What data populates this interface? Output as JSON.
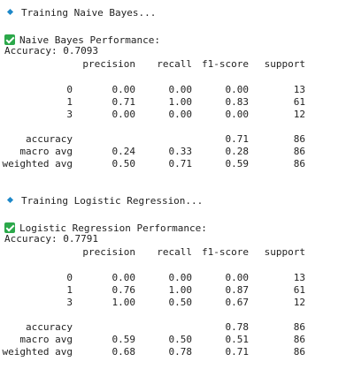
{
  "sections": [
    {
      "training_label": "Training Naive Bayes...",
      "performance_label": "Naive Bayes Performance:",
      "accuracy_line": "Accuracy: 0.7093",
      "headers": [
        "precision",
        "recall",
        "f1-score",
        "support"
      ],
      "class_rows": [
        {
          "label": "0",
          "precision": "0.00",
          "recall": "0.00",
          "f1": "0.00",
          "support": "13"
        },
        {
          "label": "1",
          "precision": "0.71",
          "recall": "1.00",
          "f1": "0.83",
          "support": "61"
        },
        {
          "label": "3",
          "precision": "0.00",
          "recall": "0.00",
          "f1": "0.00",
          "support": "12"
        }
      ],
      "summary_rows": [
        {
          "label": "accuracy",
          "precision": "",
          "recall": "",
          "f1": "0.71",
          "support": "86"
        },
        {
          "label": "macro avg",
          "precision": "0.24",
          "recall": "0.33",
          "f1": "0.28",
          "support": "86"
        },
        {
          "label": "weighted avg",
          "precision": "0.50",
          "recall": "0.71",
          "f1": "0.59",
          "support": "86"
        }
      ]
    },
    {
      "training_label": "Training Logistic Regression...",
      "performance_label": "Logistic Regression Performance:",
      "accuracy_line": "Accuracy: 0.7791",
      "headers": [
        "precision",
        "recall",
        "f1-score",
        "support"
      ],
      "class_rows": [
        {
          "label": "0",
          "precision": "0.00",
          "recall": "0.00",
          "f1": "0.00",
          "support": "13"
        },
        {
          "label": "1",
          "precision": "0.76",
          "recall": "1.00",
          "f1": "0.87",
          "support": "61"
        },
        {
          "label": "3",
          "precision": "1.00",
          "recall": "0.50",
          "f1": "0.67",
          "support": "12"
        }
      ],
      "summary_rows": [
        {
          "label": "accuracy",
          "precision": "",
          "recall": "",
          "f1": "0.78",
          "support": "86"
        },
        {
          "label": "macro avg",
          "precision": "0.59",
          "recall": "0.50",
          "f1": "0.51",
          "support": "86"
        },
        {
          "label": "weighted avg",
          "precision": "0.68",
          "recall": "0.78",
          "f1": "0.71",
          "support": "86"
        }
      ]
    }
  ],
  "icons": {
    "bullet": "blue-diamond-icon",
    "check": "green-check-icon"
  },
  "colors": {
    "bullet": "#1e88c8",
    "check": "#2ba84a",
    "text": "#1f1f1f",
    "background": "#ffffff"
  }
}
